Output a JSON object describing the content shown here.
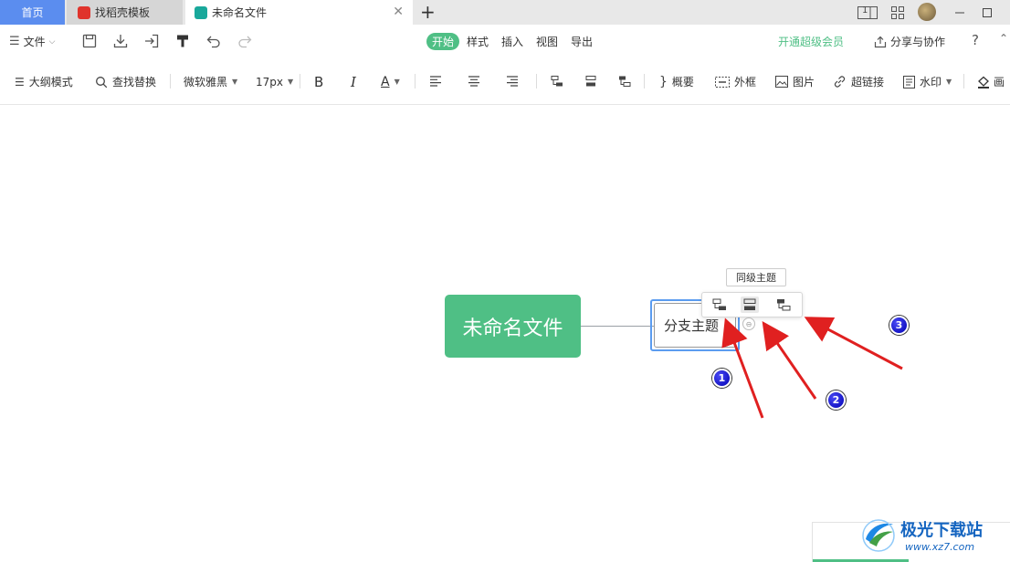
{
  "tabs": {
    "home": "首页",
    "template": "找稻壳模板",
    "document": "未命名文件"
  },
  "window": {
    "page_indicator": "1"
  },
  "menu": {
    "file": "文件",
    "tabs": [
      "开始",
      "样式",
      "插入",
      "视图",
      "导出"
    ],
    "active_tab": "开始",
    "vip": "开通超级会员",
    "share": "分享与协作",
    "help": "?"
  },
  "toolbar": {
    "outline_mode": "大纲模式",
    "find_replace": "查找替换",
    "font_family": "微软雅黑",
    "font_size": "17px",
    "bold": "B",
    "italic": "I",
    "font_color": "A",
    "summary": "概要",
    "frame": "外框",
    "image": "图片",
    "hyperlink": "超链接",
    "watermark": "水印",
    "more": "画"
  },
  "canvas": {
    "root_topic": "未命名文件",
    "branch_topic": "分支主题",
    "tooltip": "同级主题",
    "badges": [
      "1",
      "2",
      "3"
    ]
  },
  "overlay_watermark": {
    "name": "极光下载站",
    "url": "www.xz7.com"
  },
  "colors": {
    "accent_green": "#4fbf85",
    "home_tab": "#5b8def",
    "selection_blue": "#5b9cf0",
    "arrow_red": "#e02020",
    "badge_blue": "#0000c8"
  }
}
